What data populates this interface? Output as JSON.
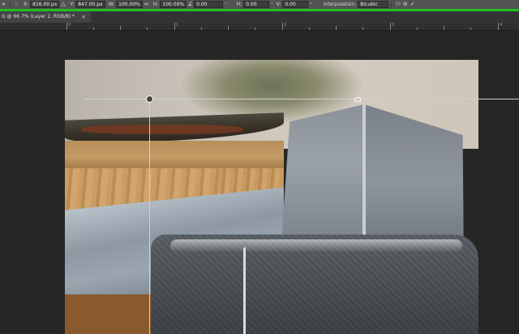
{
  "optbar": {
    "x_label": "X:",
    "x_value": "816.00 px",
    "y_label": "Y:",
    "y_value": "847.00 px",
    "w_label": "W:",
    "w_value": "100.00%",
    "h_label": "H:",
    "h_value": "100.00%",
    "angle_value": "0.00",
    "hskew_label": "H:",
    "hskew_value": "0.00",
    "vskew_label": "V:",
    "vskew_value": "0.00",
    "interp_label": "Interpolation:",
    "interp_value": "Bicubic"
  },
  "tab": {
    "title": "G @ 66.7% (Layer 2, RGB/8) *",
    "close": "×"
  },
  "ruler": {
    "labels": [
      "0",
      "1",
      "2",
      "3",
      "4"
    ]
  }
}
